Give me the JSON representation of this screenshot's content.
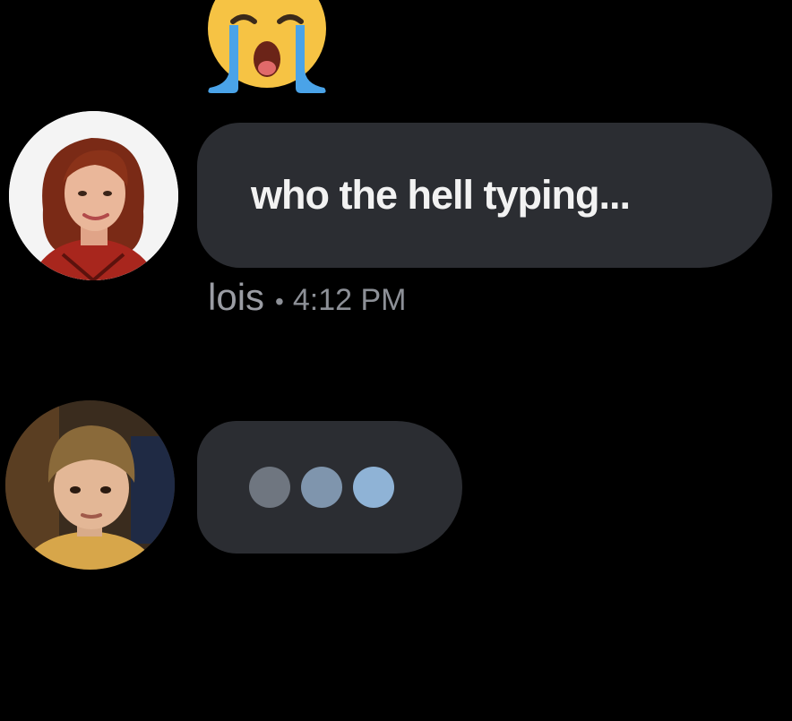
{
  "conversation": {
    "top_reaction": {
      "icon": "loudly-crying-face-emoji"
    },
    "message": {
      "text": "who the hell typing...",
      "sender_name": "lois",
      "separator": "•",
      "timestamp": "4:12 PM",
      "avatar_icon": "woman-red-hair-avatar"
    },
    "typing_indicator": {
      "avatar_icon": "boy-blond-bowl-cut-avatar",
      "dot_count": 3,
      "dot_colors": [
        "#6f7680",
        "#7f95ad",
        "#8fb3d6"
      ]
    }
  },
  "colors": {
    "background": "#000000",
    "bubble": "#2b2d32",
    "bubble_text": "#f2f2f2",
    "meta_text": "#8d9097"
  }
}
